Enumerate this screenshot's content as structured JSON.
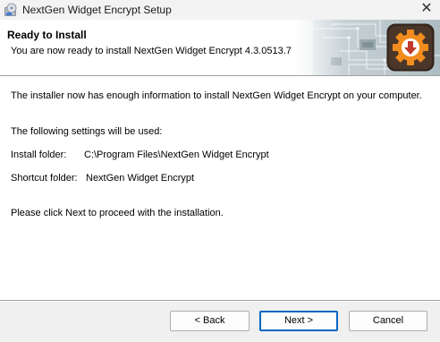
{
  "window": {
    "title": "NextGen Widget Encrypt Setup",
    "close_glyph": "✕"
  },
  "header": {
    "title": "Ready to Install",
    "subtitle": "You are now ready to install NextGen Widget Encrypt 4.3.0513.7"
  },
  "main": {
    "intro": "The installer now has enough information to install NextGen Widget Encrypt on your computer.",
    "settings_heading": "The following settings will be used:",
    "install_folder_label": "Install folder:",
    "install_folder_value": "C:\\Program Files\\NextGen Widget Encrypt",
    "shortcut_folder_label": "Shortcut folder:",
    "shortcut_folder_value": "NextGen Widget Encrypt",
    "instruction": "Please click Next to proceed with the installation."
  },
  "buttons": {
    "back": "< Back",
    "next": "Next >",
    "cancel": "Cancel"
  },
  "colors": {
    "logo_bg": "#3a2a20",
    "logo_gear": "#f28c1e",
    "logo_arrow": "#c0392b",
    "accent": "#0067c0"
  },
  "icons": {
    "app": "installer-disc-icon",
    "close": "close-icon",
    "logo": "gear-download-icon"
  }
}
